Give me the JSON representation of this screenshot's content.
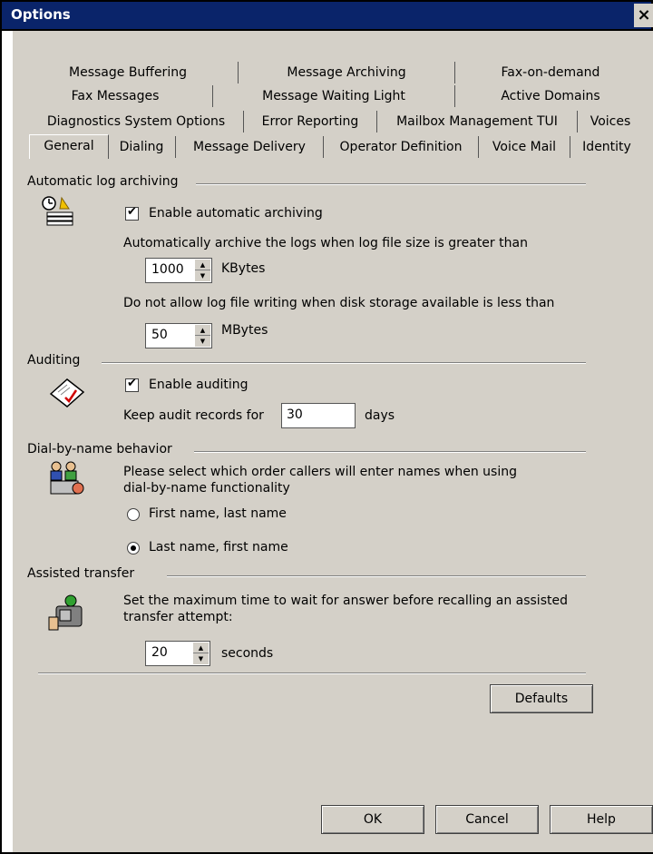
{
  "window": {
    "title": "Options",
    "close_glyph": "×"
  },
  "tabs": {
    "row1": [
      "Message Buffering",
      "Message Archiving",
      "Fax-on-demand"
    ],
    "row2": [
      "Fax Messages",
      "Message Waiting Light",
      "Active Domains"
    ],
    "row3": [
      "Diagnostics System Options",
      "Error Reporting",
      "Mailbox Management TUI",
      "Voices"
    ],
    "row4": [
      "General",
      "Dialing",
      "Message Delivery",
      "Operator Definition",
      "Voice Mail",
      "Identity"
    ],
    "active": "General"
  },
  "archiving": {
    "title": "Automatic log archiving",
    "icon": "archive-log-icon",
    "enable_label": "Enable automatic archiving",
    "enable_checked": true,
    "size_text": "Automatically archive the logs when log file size is greater than",
    "size_value": "1000",
    "size_unit": "KBytes",
    "disk_text": "Do not allow log file writing when disk storage available is less than",
    "disk_value": "50",
    "disk_unit": "MBytes"
  },
  "auditing": {
    "title": "Auditing",
    "icon": "audit-notebook-icon",
    "enable_label": "Enable auditing",
    "enable_checked": true,
    "keep_label": "Keep audit records for",
    "keep_value": "30",
    "keep_unit": "days"
  },
  "dialbyname": {
    "title": "Dial-by-name behavior",
    "icon": "directory-people-icon",
    "desc_line1": "Please select which order callers will enter names when using",
    "desc_line2": "dial-by-name functionality",
    "option1": "First name, last name",
    "option2": "Last name, first name",
    "selected": "option2"
  },
  "assisted": {
    "title": "Assisted transfer",
    "icon": "phone-transfer-icon",
    "desc_line1": "Set the maximum time to wait for answer before recalling an assisted",
    "desc_line2": "transfer attempt:",
    "value": "20",
    "unit": "seconds"
  },
  "buttons": {
    "defaults": "Defaults",
    "ok": "OK",
    "cancel": "Cancel",
    "help": "Help"
  }
}
